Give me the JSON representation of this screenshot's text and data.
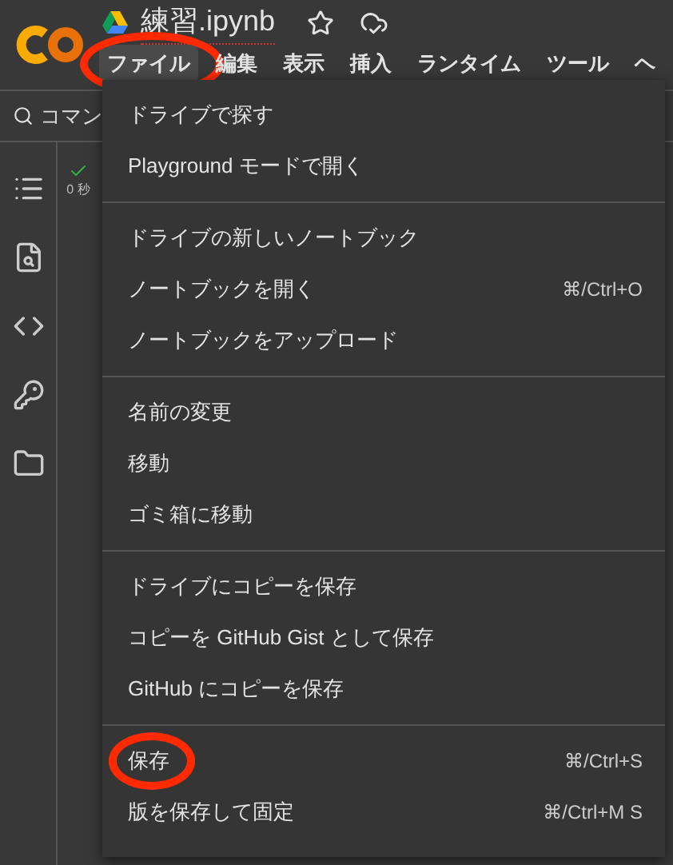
{
  "title": "練習.ipynb",
  "menubar": [
    {
      "label": "ファイル",
      "selected": true,
      "circled": true
    },
    {
      "label": "編集",
      "selected": false,
      "circled": false
    },
    {
      "label": "表示",
      "selected": false,
      "circled": false
    },
    {
      "label": "挿入",
      "selected": false,
      "circled": false
    },
    {
      "label": "ランタイム",
      "selected": false,
      "circled": false
    },
    {
      "label": "ツール",
      "selected": false,
      "circled": false
    },
    {
      "label": "ヘ",
      "selected": false,
      "circled": false
    }
  ],
  "search": {
    "placeholder": "コマン"
  },
  "cell": {
    "status": "0 秒"
  },
  "menu": [
    [
      {
        "label": "ドライブで探す",
        "circled": false
      },
      {
        "label": "Playground モードで開く",
        "circled": false
      }
    ],
    [
      {
        "label": "ドライブの新しいノートブック",
        "circled": false
      },
      {
        "label": "ノートブックを開く",
        "shortcut": "⌘/Ctrl+O",
        "circled": false
      },
      {
        "label": "ノートブックをアップロード",
        "circled": false
      }
    ],
    [
      {
        "label": "名前の変更",
        "circled": false
      },
      {
        "label": "移動",
        "circled": false
      },
      {
        "label": "ゴミ箱に移動",
        "circled": false
      }
    ],
    [
      {
        "label": "ドライブにコピーを保存",
        "circled": false
      },
      {
        "label": "コピーを GitHub Gist として保存",
        "circled": false
      },
      {
        "label": "GitHub にコピーを保存",
        "circled": false
      }
    ],
    [
      {
        "label": "保存",
        "shortcut": "⌘/Ctrl+S",
        "circled": true
      },
      {
        "label": "版を保存して固定",
        "shortcut": "⌘/Ctrl+M S",
        "circled": false
      }
    ]
  ]
}
